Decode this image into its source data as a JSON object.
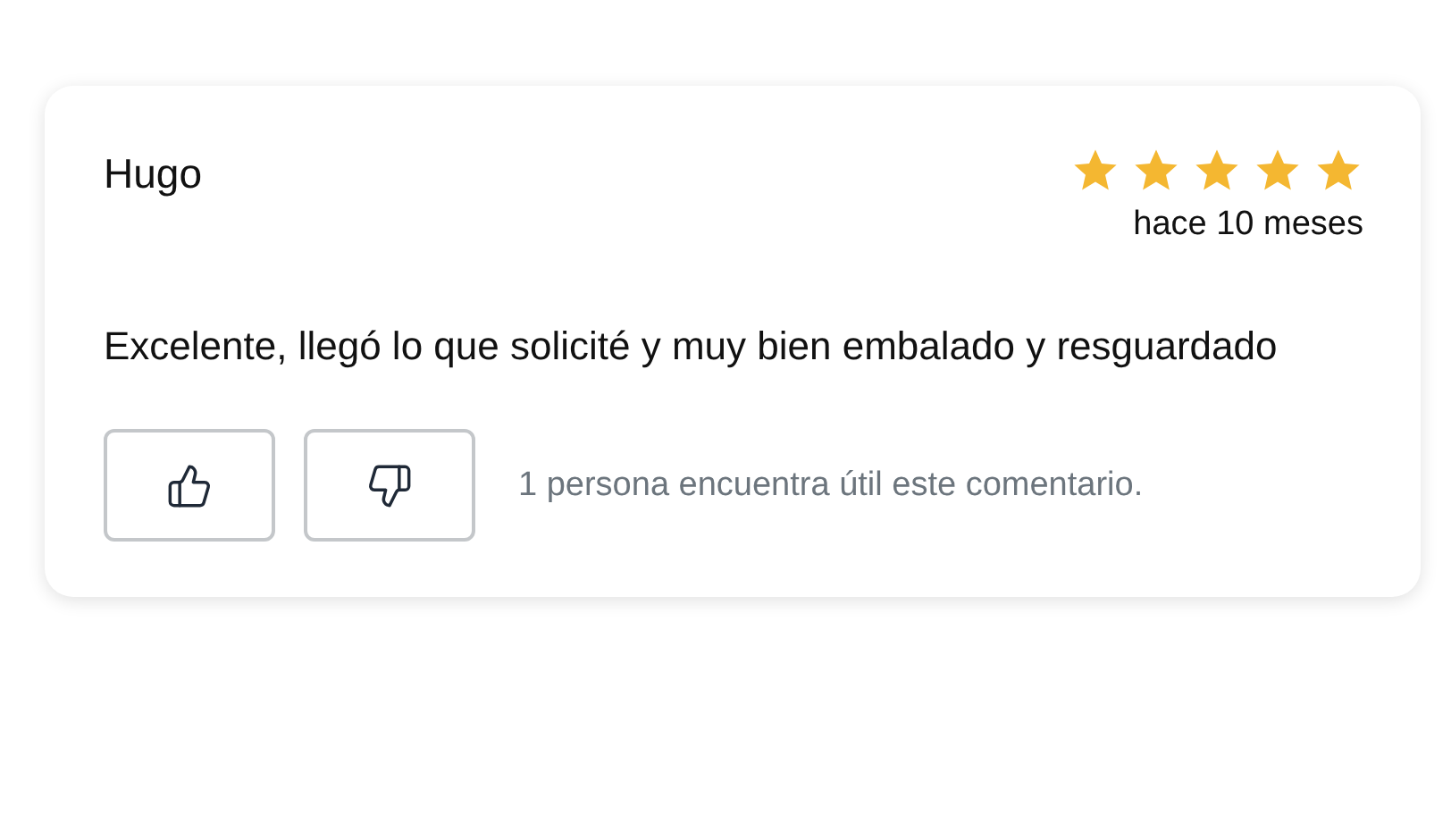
{
  "review": {
    "author": "Hugo",
    "stars": 5,
    "time": "hace 10 meses",
    "comment": "Excelente, llegó lo que solicité y muy bien embalado y resguardado",
    "votes": [
      {
        "kind": "like"
      },
      {
        "kind": "dislike"
      }
    ],
    "helpful": "1 persona encuentra útil este comentario."
  }
}
